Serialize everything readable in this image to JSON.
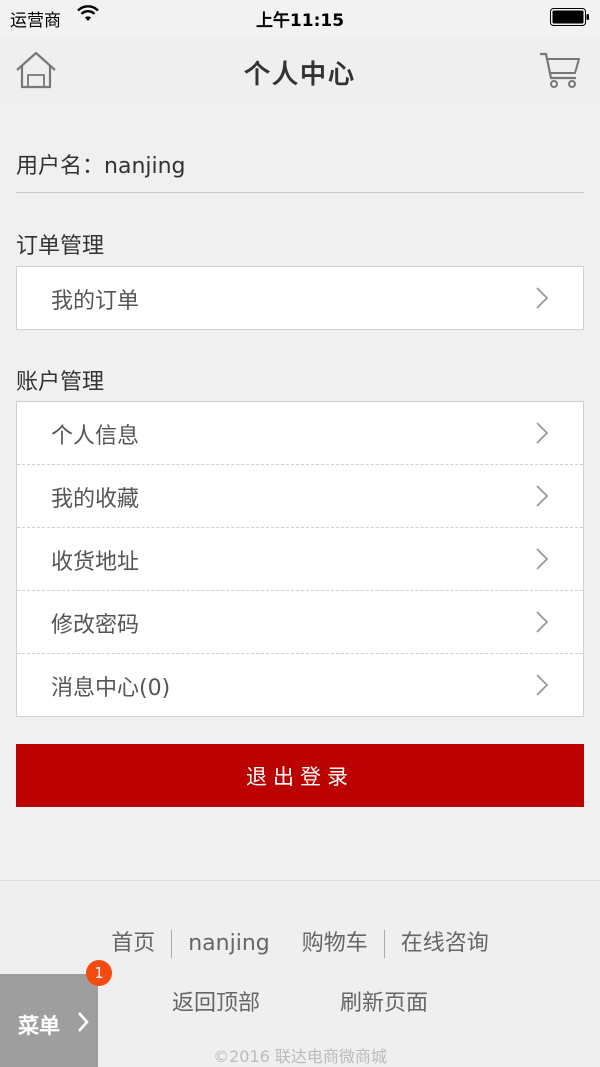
{
  "status_bar": {
    "carrier": "运营商",
    "time": "上午11:15"
  },
  "nav": {
    "title": "个人中心",
    "home_icon": "home-icon",
    "cart_icon": "cart-icon"
  },
  "user": {
    "label": "用户名：",
    "name": "nanjing"
  },
  "order_section": {
    "title": "订单管理",
    "items": [
      {
        "label": "我的订单"
      }
    ]
  },
  "account_section": {
    "title": "账户管理",
    "items": [
      {
        "label": "个人信息"
      },
      {
        "label": "我的收藏"
      },
      {
        "label": "收货地址"
      },
      {
        "label": "修改密码"
      },
      {
        "label": "消息中心(0)"
      }
    ]
  },
  "logout": {
    "label": "退出登录"
  },
  "footer": {
    "links": [
      "首页",
      "nanjing",
      "购物车",
      "在线咨询"
    ],
    "links2": [
      "返回顶部",
      "刷新页面"
    ],
    "copyright": "©2016 联达电商微商城"
  },
  "menu": {
    "label": "菜单",
    "badge": "1"
  },
  "colors": {
    "accent": "#bb0000",
    "badge": "#f44b10"
  }
}
